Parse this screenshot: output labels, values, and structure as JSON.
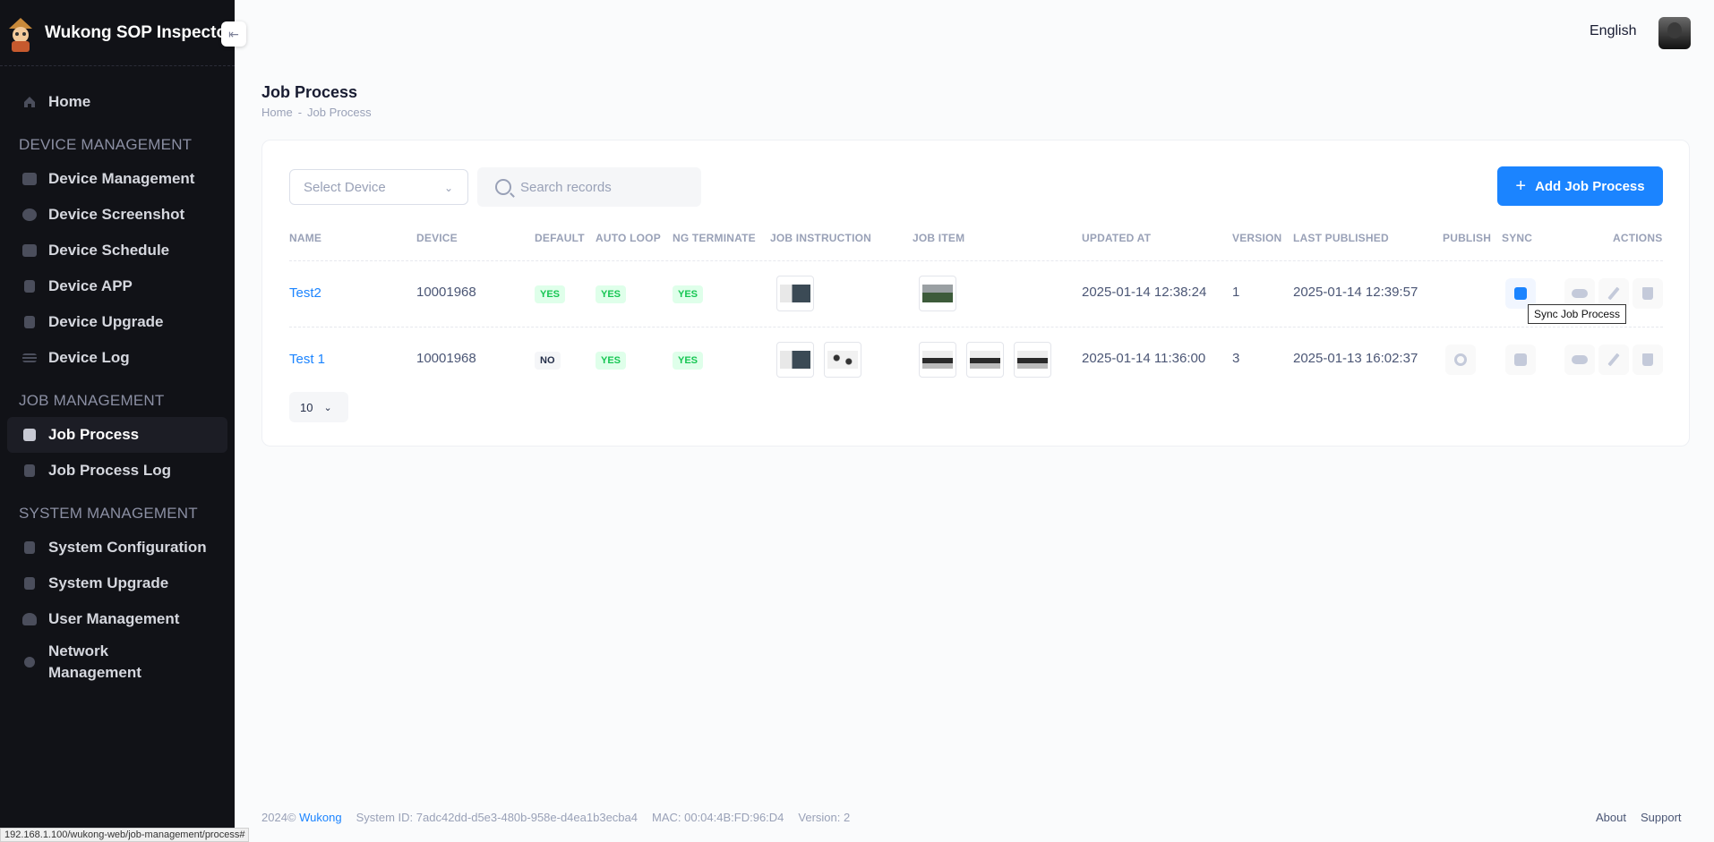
{
  "app": {
    "title": "Wukong SOP Inspector",
    "collapse_icon": "arrow-left-icon"
  },
  "header": {
    "language": "English"
  },
  "sidebar": {
    "home": "Home",
    "sections": [
      {
        "title": "DEVICE MANAGEMENT",
        "items": [
          "Device Management",
          "Device Screenshot",
          "Device Schedule",
          "Device APP",
          "Device Upgrade",
          "Device Log"
        ]
      },
      {
        "title": "JOB MANAGEMENT",
        "items": [
          "Job Process",
          "Job Process Log"
        ]
      },
      {
        "title": "SYSTEM MANAGEMENT",
        "items": [
          "System Configuration",
          "System Upgrade",
          "User Management",
          "Network Management"
        ]
      }
    ],
    "active": "Job Process"
  },
  "page": {
    "title": "Job Process",
    "breadcrumb": [
      "Home",
      "-",
      "Job Process"
    ]
  },
  "toolbar": {
    "select_placeholder": "Select Device",
    "search_placeholder": "Search records",
    "add_button": "Add Job Process"
  },
  "table": {
    "columns": [
      "NAME",
      "DEVICE",
      "DEFAULT",
      "AUTO LOOP",
      "NG TERMINATE",
      "JOB INSTRUCTION",
      "JOB ITEM",
      "UPDATED AT",
      "VERSION",
      "LAST PUBLISHED",
      "PUBLISH",
      "SYNC",
      "ACTIONS"
    ],
    "rows": [
      {
        "name": "Test2",
        "device": "10001968",
        "default": "YES",
        "auto_loop": "YES",
        "ng_terminate": "YES",
        "updated_at": "2025-01-14 12:38:24",
        "version": "1",
        "last_published": "2025-01-14 12:39:57"
      },
      {
        "name": "Test 1",
        "device": "10001968",
        "default": "NO",
        "auto_loop": "YES",
        "ng_terminate": "YES",
        "updated_at": "2025-01-14 11:36:00",
        "version": "3",
        "last_published": "2025-01-13 16:02:37"
      }
    ],
    "page_size": "10"
  },
  "tooltip": "Sync Job Process",
  "footer": {
    "copyright": "2024©",
    "brand": "Wukong",
    "system_id": "System ID: 7adc42dd-d5e3-480b-958e-d4ea1b3ecba4",
    "mac": "MAC: 00:04:4B:FD:96:D4",
    "version": "Version: 2",
    "about": "About",
    "support": "Support"
  },
  "status_url": "192.168.1.100/wukong-web/job-management/process#"
}
